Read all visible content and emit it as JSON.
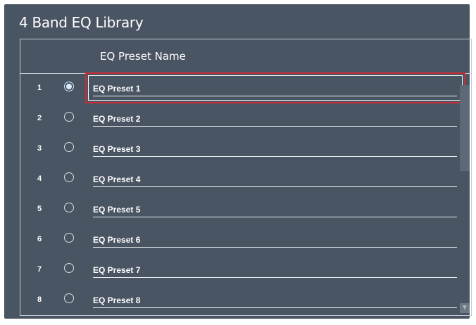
{
  "library": {
    "title": "4 Band EQ Library",
    "column_header": "EQ Preset Name",
    "selected_index": 1,
    "rows": [
      {
        "num": "1",
        "name": "EQ Preset 1",
        "selected": true
      },
      {
        "num": "2",
        "name": "EQ Preset 2",
        "selected": false
      },
      {
        "num": "3",
        "name": "EQ Preset 3",
        "selected": false
      },
      {
        "num": "4",
        "name": "EQ Preset 4",
        "selected": false
      },
      {
        "num": "5",
        "name": "EQ Preset 5",
        "selected": false
      },
      {
        "num": "6",
        "name": "EQ Preset 6",
        "selected": false
      },
      {
        "num": "7",
        "name": "EQ Preset 7",
        "selected": false
      },
      {
        "num": "8",
        "name": "EQ Preset 8",
        "selected": false
      }
    ]
  },
  "scrollbar": {
    "down_icon": "arrow-down-icon"
  },
  "colors": {
    "panel_background": "#4a5563",
    "focus_outline": "#c82d36",
    "text": "#ffffff"
  }
}
